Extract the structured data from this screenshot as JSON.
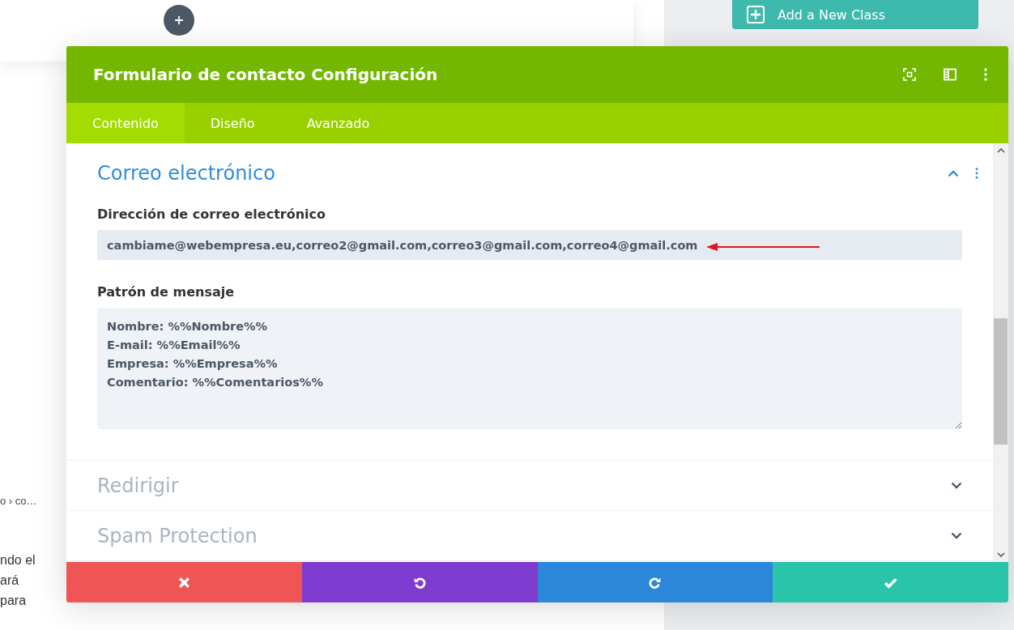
{
  "background": {
    "add_class_button": "Add a New Class",
    "text_fragments": [
      "o › co…",
      "ndo el",
      "ará",
      "para"
    ]
  },
  "modal": {
    "title": "Formulario de contacto Configuración",
    "tabs": [
      {
        "label": "Contenido",
        "selected": true
      },
      {
        "label": "Diseño",
        "selected": false
      },
      {
        "label": "Avanzado",
        "selected": false
      }
    ],
    "sections": [
      {
        "title": "Correo electrónico",
        "expanded": true,
        "fields": [
          {
            "kind": "input",
            "label": "Dirección de correo electrónico",
            "value": "cambiame@webempresa.eu,correo2@gmail.com,correo3@gmail.com,correo4@gmail.com"
          },
          {
            "kind": "textarea",
            "label": "Patrón de mensaje",
            "value": "Nombre: %%Nombre%%\nE-mail: %%Email%%\nEmpresa: %%Empresa%%\nComentario: %%Comentarios%%"
          }
        ]
      },
      {
        "title": "Redirigir",
        "expanded": false
      },
      {
        "title": "Spam Protection",
        "expanded": false
      }
    ],
    "footer_buttons": [
      {
        "kind": "discard"
      },
      {
        "kind": "undo"
      },
      {
        "kind": "redo"
      },
      {
        "kind": "save"
      }
    ]
  }
}
